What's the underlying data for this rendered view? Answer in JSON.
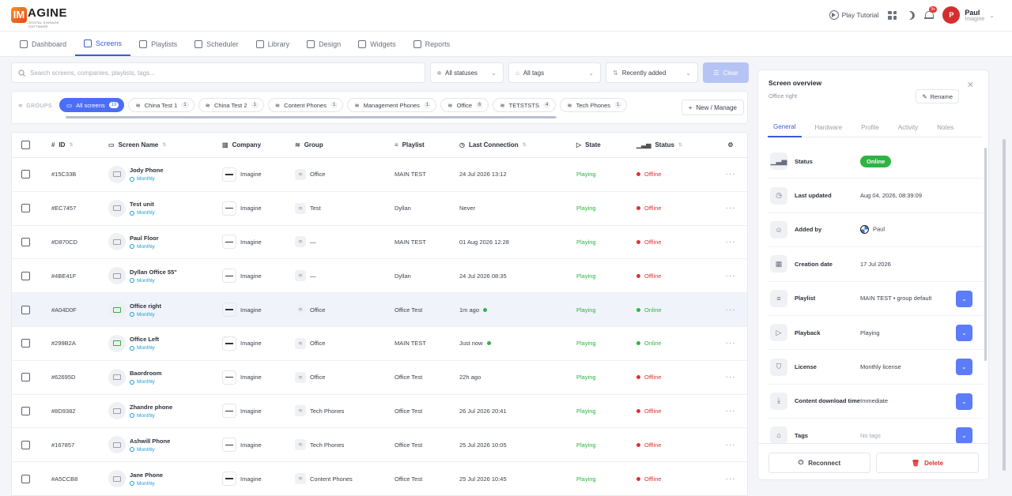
{
  "app": {
    "logo_letters": "IM",
    "logo_text": "AGINE",
    "logo_sub": "DIGITAL SIGNAGE SOFTWARE"
  },
  "topbar": {
    "play_tutorial": "Play Tutorial",
    "notif_badge": "9+",
    "user_initial": "P",
    "user_name": "Paul",
    "user_org": "Imagine"
  },
  "nav": [
    {
      "label": "Dashboard",
      "icon": "dashboard-icon"
    },
    {
      "label": "Screens",
      "icon": "monitor-icon",
      "active": true
    },
    {
      "label": "Playlists",
      "icon": "playlist-icon"
    },
    {
      "label": "Scheduler",
      "icon": "calendar-icon"
    },
    {
      "label": "Library",
      "icon": "folder-icon"
    },
    {
      "label": "Design",
      "icon": "palette-icon"
    },
    {
      "label": "Widgets",
      "icon": "widgets-icon"
    },
    {
      "label": "Reports",
      "icon": "chart-icon"
    }
  ],
  "filters": {
    "search_placeholder": "Search screens, companies, playlists, tags...",
    "statuses": "All statuses",
    "tags": "All tags",
    "sort": "Recently added",
    "clear": "Clear"
  },
  "groups": {
    "label": "GROUPS",
    "new_manage": "New / Manage",
    "chips": [
      {
        "label": "All screens",
        "count": "19",
        "active": true
      },
      {
        "label": "China Test 1",
        "count": "1"
      },
      {
        "label": "China Test 2",
        "count": "1"
      },
      {
        "label": "Content Phones",
        "count": "1"
      },
      {
        "label": "Management Phones",
        "count": "1"
      },
      {
        "label": "Office",
        "count": "6"
      },
      {
        "label": "TETSTSTS",
        "count": "4"
      },
      {
        "label": "Tech Phones",
        "count": "1"
      }
    ]
  },
  "table": {
    "headers": {
      "id": "ID",
      "name": "Screen Name",
      "company": "Company",
      "group": "Group",
      "playlist": "Playlist",
      "last": "Last Connection",
      "state": "State",
      "status": "Status"
    },
    "rows": [
      {
        "id": "#15C33B",
        "name": "Jody Phone",
        "plan": "Monthly",
        "company": "Imagine",
        "group": "Office",
        "playlist": "MAIN TEST",
        "last": "24 Jul 2026 13:12",
        "state": "Playing",
        "status": "Offline"
      },
      {
        "id": "#EC7457",
        "name": "Test unit",
        "plan": "Monthly",
        "company": "Imagine",
        "group": "Test",
        "playlist": "Dyllan",
        "last": "Never",
        "state": "Playing",
        "status": "Offline"
      },
      {
        "id": "#D870CD",
        "name": "Paul Floor",
        "plan": "Monthly",
        "company": "Imagine",
        "group": "—",
        "playlist": "MAIN TEST",
        "last": "01 Aug 2026 12:28",
        "state": "Playing",
        "status": "Offline"
      },
      {
        "id": "#4BE41F",
        "name": "Dyllan Office 55\"",
        "plan": "Monthly",
        "company": "Imagine",
        "group": "—",
        "playlist": "Dyllan",
        "last": "24 Jul 2026 08:35",
        "state": "Playing",
        "status": "Offline"
      },
      {
        "id": "#A04D0F",
        "name": "Office right",
        "plan": "Monthly",
        "company": "Imagine",
        "group": "Office",
        "playlist": "Office Test",
        "last": "1m ago",
        "state": "Playing",
        "status": "Online"
      },
      {
        "id": "#299B2A",
        "name": "Office Left",
        "plan": "Monthly",
        "company": "Imagine",
        "group": "Office",
        "playlist": "MAIN TEST",
        "last": "Just now",
        "state": "Playing",
        "status": "Online"
      },
      {
        "id": "#62695D",
        "name": "Baordroom",
        "plan": "Monthly",
        "company": "Imagine",
        "group": "Office",
        "playlist": "Office Test",
        "last": "22h ago",
        "state": "Playing",
        "status": "Offline"
      },
      {
        "id": "#8D9382",
        "name": "Zhandre phone",
        "plan": "Monthly",
        "company": "Imagine",
        "group": "Tech Phones",
        "playlist": "Office Test",
        "last": "26 Jul 2026 20:41",
        "state": "Playing",
        "status": "Offline"
      },
      {
        "id": "#167857",
        "name": "Ashwill Phone",
        "plan": "Monthly",
        "company": "Imagine",
        "group": "Tech Phones",
        "playlist": "Office Test",
        "last": "25 Jul 2026 10:05",
        "state": "Playing",
        "status": "Offline"
      },
      {
        "id": "#A5CCB8",
        "name": "Jane Phone",
        "plan": "Monthly",
        "company": "Imagine",
        "group": "Content Phones",
        "playlist": "Office Test",
        "last": "25 Jul 2026 10:45",
        "state": "Playing",
        "status": "Offline"
      }
    ]
  },
  "panel": {
    "title": "Screen overview",
    "subtitle": "Office right",
    "rename": "Rename",
    "tabs": [
      "General",
      "Hardware",
      "Profile",
      "Activity",
      "Notes"
    ],
    "fields": [
      {
        "label": "Status",
        "value": "Online",
        "icon": "signal-icon"
      },
      {
        "label": "Last updated",
        "value": "Aug 04, 2026, 08:39:09",
        "icon": "clock-icon"
      },
      {
        "label": "Added by",
        "value": "Paul",
        "icon": "user-icon"
      },
      {
        "label": "Creation date",
        "value": "17 Jul 2026",
        "icon": "calendar-icon"
      },
      {
        "label": "Playlist",
        "value": "MAIN TEST • group default",
        "icon": "playlist-icon"
      },
      {
        "label": "Playback",
        "value": "Playing",
        "icon": "play-icon"
      },
      {
        "label": "License",
        "value": "Monthly license",
        "icon": "shield-icon"
      },
      {
        "label": "Content download time",
        "value": "Immediate",
        "icon": "download-icon"
      },
      {
        "label": "Tags",
        "value": "No tags",
        "icon": "tag-icon"
      }
    ],
    "reconnect": "Reconnect",
    "delete": "Delete"
  },
  "colors": {
    "accent": "#3b5bdb",
    "online": "#2fb344",
    "offline": "#e03131"
  }
}
